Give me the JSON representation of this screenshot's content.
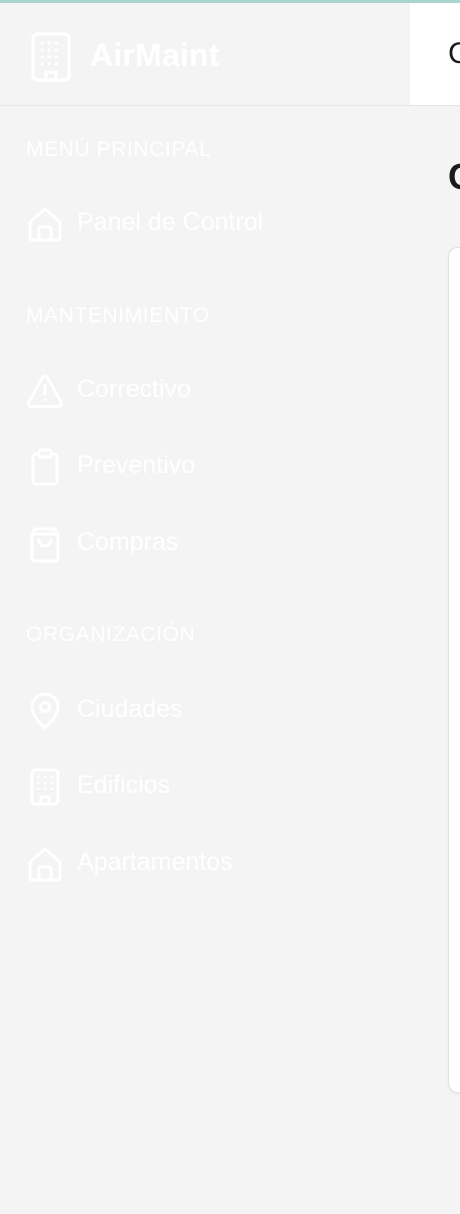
{
  "brand": {
    "name": "AirMaint",
    "icon": "building-icon"
  },
  "sidebar": {
    "sections": [
      {
        "title": "MENÚ PRINCIPAL",
        "items": [
          {
            "label": "Panel de Control",
            "icon": "home-icon"
          }
        ]
      },
      {
        "title": "MANTENIMIENTO",
        "items": [
          {
            "label": "Correctivo",
            "icon": "warning-triangle-icon"
          },
          {
            "label": "Preventivo",
            "icon": "clipboard-icon"
          },
          {
            "label": "Compras",
            "icon": "shopping-bag-icon"
          }
        ]
      },
      {
        "title": "ORGANIZACIÓN",
        "items": [
          {
            "label": "Ciudades",
            "icon": "map-pin-icon"
          },
          {
            "label": "Edificios",
            "icon": "building-icon"
          },
          {
            "label": "Apartamentos",
            "icon": "home-icon"
          }
        ]
      }
    ]
  },
  "main": {
    "header_text": "C",
    "title": "C"
  },
  "colors": {
    "sidebar_bg": "#f4f4f4",
    "sidebar_text": "#ffffff",
    "top_strip": "#a8d4d2",
    "main_bg": "#ffffff"
  }
}
